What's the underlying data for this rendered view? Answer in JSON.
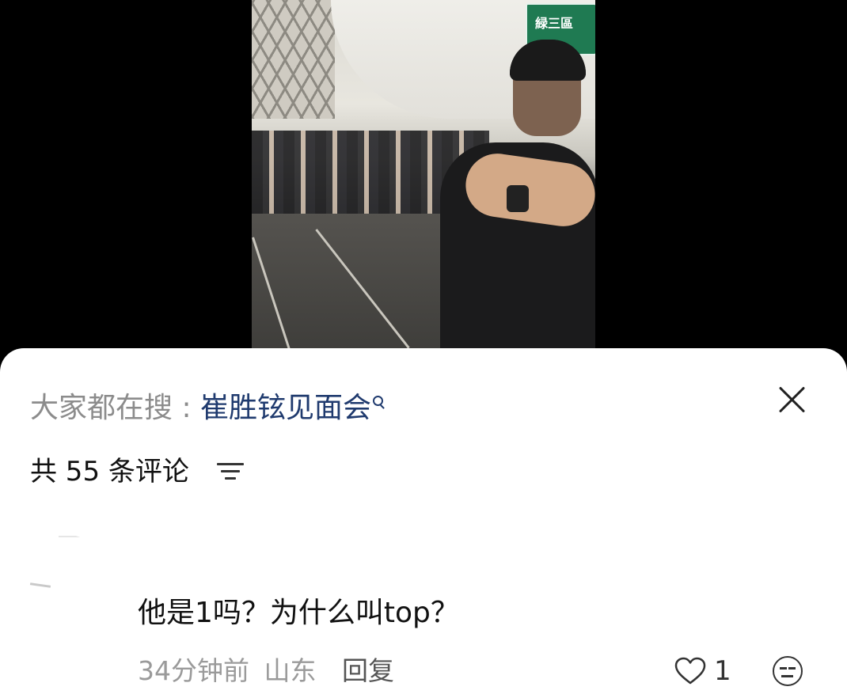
{
  "video": {
    "sign_text": "緑三區"
  },
  "sheet": {
    "hot_search_prefix": "大家都在搜 : ",
    "hot_search_term": "崔胜铉见面会",
    "comment_count_text": "共 55 条评论",
    "comments": [
      {
        "text": "他是1吗？为什么叫top？",
        "time": "34分钟前",
        "location": "山东",
        "reply_label": "回复",
        "likes": "1"
      }
    ]
  },
  "icons": {
    "close": "close-icon",
    "sort": "sort-icon",
    "search": "search-icon",
    "like": "heart-icon",
    "emoji": "emoji-face-icon"
  }
}
